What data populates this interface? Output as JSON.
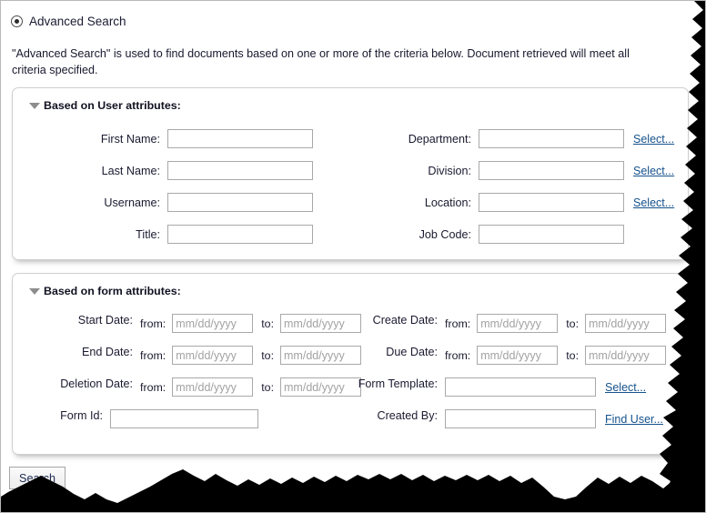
{
  "header": {
    "radio_label": "Advanced Search",
    "radio_selected": true
  },
  "description": "\"Advanced Search\" is used to find documents based on one or more of the criteria below. Document retrieved will meet all criteria specified.",
  "panels": [
    {
      "id": "user",
      "title": "Based on User attributes:",
      "expanded": true,
      "left_fields": [
        {
          "label": "First Name:",
          "value": "",
          "placeholder": ""
        },
        {
          "label": "Last Name:",
          "value": "",
          "placeholder": ""
        },
        {
          "label": "Username:",
          "value": "",
          "placeholder": ""
        },
        {
          "label": "Title:",
          "value": "",
          "placeholder": ""
        }
      ],
      "right_fields": [
        {
          "label": "Department:",
          "value": "",
          "placeholder": "",
          "link": "Select..."
        },
        {
          "label": "Division:",
          "value": "",
          "placeholder": "",
          "link": "Select..."
        },
        {
          "label": "Location:",
          "value": "",
          "placeholder": "",
          "link": "Select..."
        },
        {
          "label": "Job Code:",
          "value": "",
          "placeholder": "",
          "link": ""
        }
      ]
    },
    {
      "id": "form",
      "title": "Based on form attributes:",
      "expanded": true,
      "left_fields": [
        {
          "label": "Start Date:",
          "type": "range",
          "from_label": "from:",
          "to_label": "to:",
          "from_value": "",
          "to_value": "",
          "placeholder": "mm/dd/yyyy"
        },
        {
          "label": "End Date:",
          "type": "range",
          "from_label": "from:",
          "to_label": "to:",
          "from_value": "",
          "to_value": "",
          "placeholder": "mm/dd/yyyy"
        },
        {
          "label": "Deletion Date:",
          "type": "range",
          "from_label": "from:",
          "to_label": "to:",
          "from_value": "",
          "to_value": "",
          "placeholder": "mm/dd/yyyy"
        },
        {
          "label": "Form Id:",
          "type": "text",
          "value": "",
          "placeholder": ""
        }
      ],
      "right_fields": [
        {
          "label": "Create Date:",
          "type": "range",
          "from_label": "from:",
          "to_label": "to:",
          "from_value": "",
          "to_value": "",
          "placeholder": "mm/dd/yyyy"
        },
        {
          "label": "Due Date:",
          "type": "range",
          "from_label": "from:",
          "to_label": "to:",
          "from_value": "",
          "to_value": "",
          "placeholder": "mm/dd/yyyy"
        },
        {
          "label": "Form Template:",
          "type": "text",
          "value": "",
          "placeholder": "",
          "link": "Select..."
        },
        {
          "label": "Created By:",
          "type": "text",
          "value": "",
          "placeholder": "",
          "link": "Find User..."
        }
      ]
    }
  ],
  "footer": {
    "search_button": "Search"
  },
  "colors": {
    "link": "#16528c",
    "text": "#1a1a30",
    "field_border": "#a9a9a9",
    "panel_border": "#cfcfcf",
    "placeholder": "#a2a2a2",
    "torn_edge": "#000000"
  }
}
